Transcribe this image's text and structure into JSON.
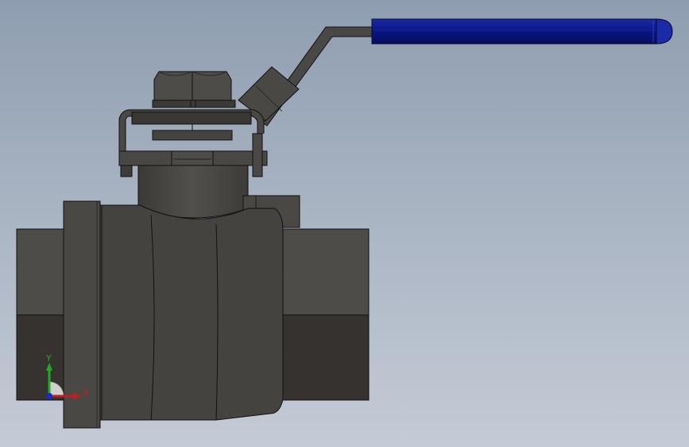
{
  "viewport": {
    "background_top": "#8e9db0",
    "background_bottom": "#c4cbd6"
  },
  "model": {
    "body_color": "#4a4844",
    "body_dark": "#35322f",
    "handle_grip_color": "#0a1a8a"
  },
  "triad": {
    "x_label": "X",
    "y_label": "Y",
    "x_color": "#cc1a1a",
    "y_color": "#22aa22",
    "z_color": "#1a2acc"
  }
}
